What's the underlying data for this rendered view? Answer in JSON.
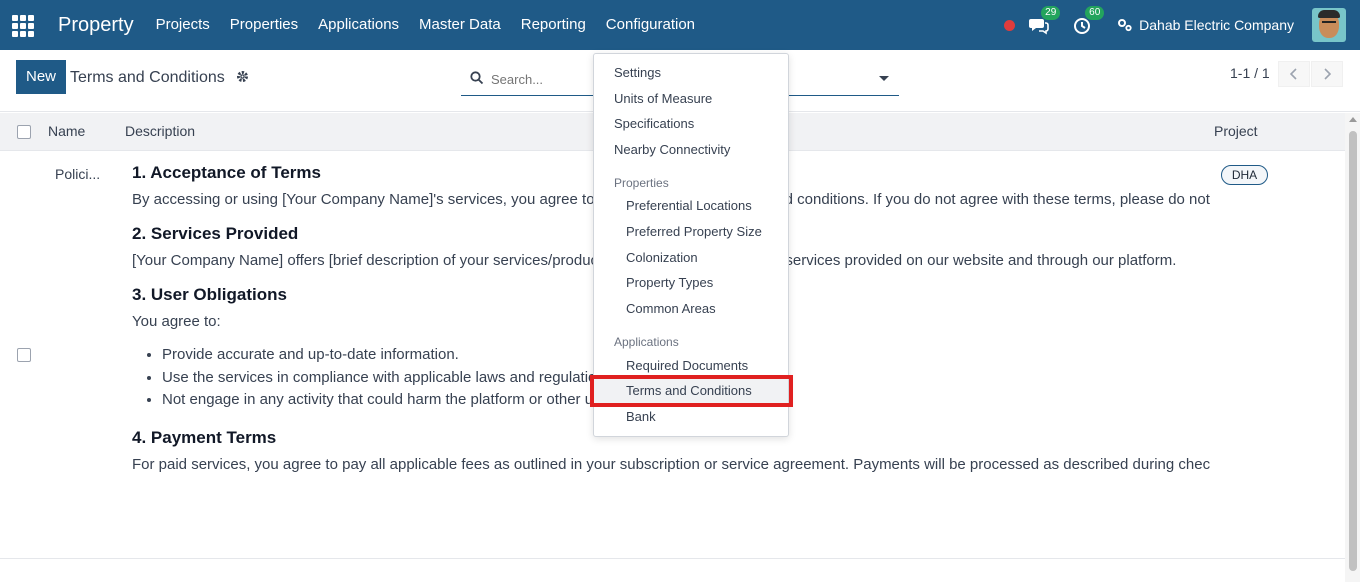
{
  "navbar": {
    "brand": "Property",
    "menu": [
      "Projects",
      "Properties",
      "Applications",
      "Master Data",
      "Reporting",
      "Configuration"
    ],
    "chat_badge": "29",
    "activity_badge": "60",
    "company": "Dahab Electric Company",
    "colors": {
      "bar": "#1f5a87",
      "badge": "#23a45d",
      "record": "#e03c3c"
    }
  },
  "control": {
    "new_label": "New",
    "title": "Terms and Conditions",
    "search_placeholder": "Search...",
    "pager": "1-1 / 1"
  },
  "list": {
    "headers": {
      "name": "Name",
      "description": "Description",
      "project": "Project"
    },
    "row": {
      "name": "Polici...",
      "project_tag": "DHA",
      "description": {
        "h1": "1. Acceptance of Terms",
        "p1": "By accessing or using [Your Company Name]'s services, you agree to be bound by these terms and conditions. If you do not agree with these terms, please do not use our services.",
        "h2": "2. Services Provided",
        "p2": "[Your Company Name] offers [brief description of your services/products]. These terms apply to all services provided on our website and through our platform.",
        "h3": "3. User Obligations",
        "p3": "You agree to:",
        "bullets": [
          "Provide accurate and up-to-date information.",
          "Use the services in compliance with applicable laws and regulations.",
          "Not engage in any activity that could harm the platform or other users."
        ],
        "h4": "4. Payment Terms",
        "p4": "For paid services, you agree to pay all applicable fees as outlined in your subscription or service agreement. Payments will be processed as described during checkout."
      }
    }
  },
  "dropdown": {
    "top_items": [
      "Settings",
      "Units of Measure",
      "Specifications",
      "Nearby Connectivity"
    ],
    "section_properties": "Properties",
    "properties_items": [
      "Preferential Locations",
      "Preferred Property Size",
      "Colonization",
      "Property Types",
      "Common Areas"
    ],
    "section_applications": "Applications",
    "applications_items": [
      "Required Documents",
      "Terms and Conditions",
      "Bank"
    ]
  }
}
